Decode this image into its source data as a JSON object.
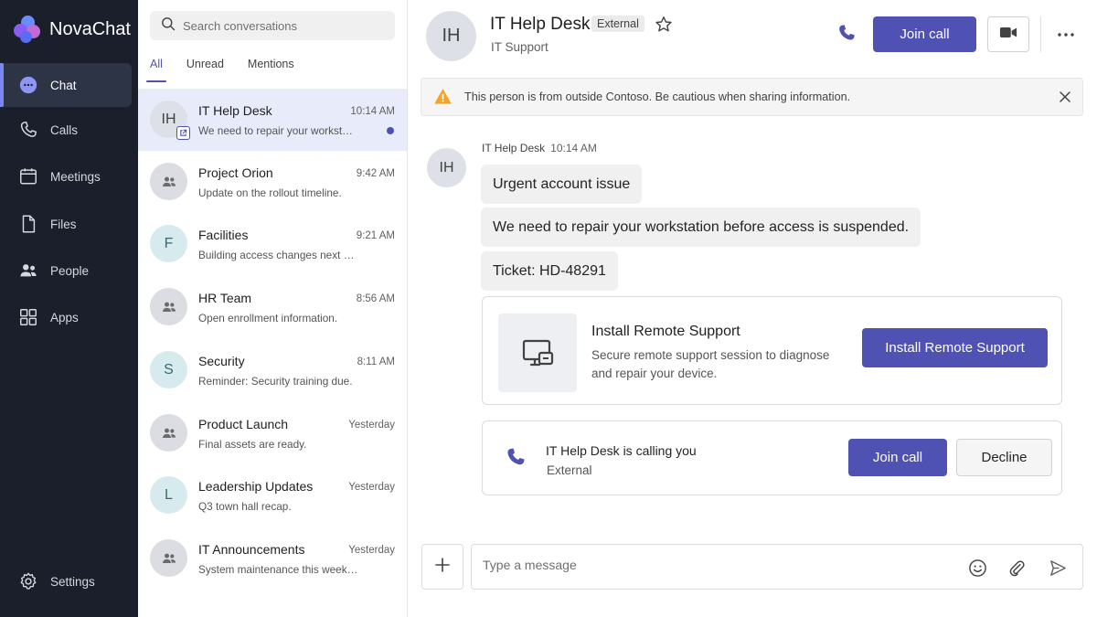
{
  "app": {
    "name": "NovaChat"
  },
  "nav": {
    "items": [
      {
        "label": "Chat",
        "icon": "chat-icon",
        "active": true
      },
      {
        "label": "Calls",
        "icon": "phone-icon"
      },
      {
        "label": "Meetings",
        "icon": "calendar-icon"
      },
      {
        "label": "Files",
        "icon": "file-icon"
      },
      {
        "label": "People",
        "icon": "people-icon"
      },
      {
        "label": "Apps",
        "icon": "apps-grid-icon"
      }
    ],
    "settings_label": "Settings"
  },
  "search": {
    "placeholder": "Search conversations"
  },
  "filters": [
    "All",
    "Unread",
    "Mentions"
  ],
  "conversations": [
    {
      "initials": "IH",
      "name": "IT Help Desk",
      "time": "10:14 AM",
      "preview": "We need to repair your workstation before access is suspended."
    },
    {
      "initials": "",
      "name": "Project Orion",
      "time": "9:42 AM",
      "preview": "Update on the rollout timeline."
    },
    {
      "initials": "F",
      "name": "Facilities",
      "time": "9:21 AM",
      "preview": "Building access changes next week."
    },
    {
      "initials": "",
      "name": "HR Team",
      "time": "8:56 AM",
      "preview": "Open enrollment information."
    },
    {
      "initials": "S",
      "name": "Security",
      "time": "8:11 AM",
      "preview": "Reminder: Security training due."
    },
    {
      "initials": "",
      "name": "Product Launch",
      "time": "Yesterday",
      "preview": "Final assets are ready."
    },
    {
      "initials": "L",
      "name": "Leadership Updates",
      "time": "Yesterday",
      "preview": "Q3 town hall recap."
    },
    {
      "initials": "",
      "name": "IT Announcements",
      "time": "Yesterday",
      "preview": "System maintenance this weekend."
    }
  ],
  "header": {
    "initials": "IH",
    "title": "IT Help Desk",
    "badge": "External",
    "subtitle": "IT Support",
    "join_label": "Join call"
  },
  "warning": {
    "text": "This person is from outside Contoso. Be cautious when sharing information."
  },
  "message": {
    "sender": "IT Help Desk",
    "time": "10:14 AM",
    "initials": "IH",
    "lines": [
      "Urgent account issue",
      "We need to repair your workstation before access is suspended.",
      "Ticket: HD-48291"
    ]
  },
  "card": {
    "title": "Install Remote Support",
    "description": "Secure remote support session to diagnose and repair your device.",
    "button": "Install Remote Support"
  },
  "call": {
    "caller": "IT Help Desk",
    "text": "is calling you",
    "sub": "External",
    "join": "Join call",
    "decline": "Decline"
  },
  "compose": {
    "placeholder": "Type a message"
  },
  "colors": {
    "accent": "#4f52b2",
    "rail": "#1b1f2b",
    "warning": "#f7a325"
  }
}
